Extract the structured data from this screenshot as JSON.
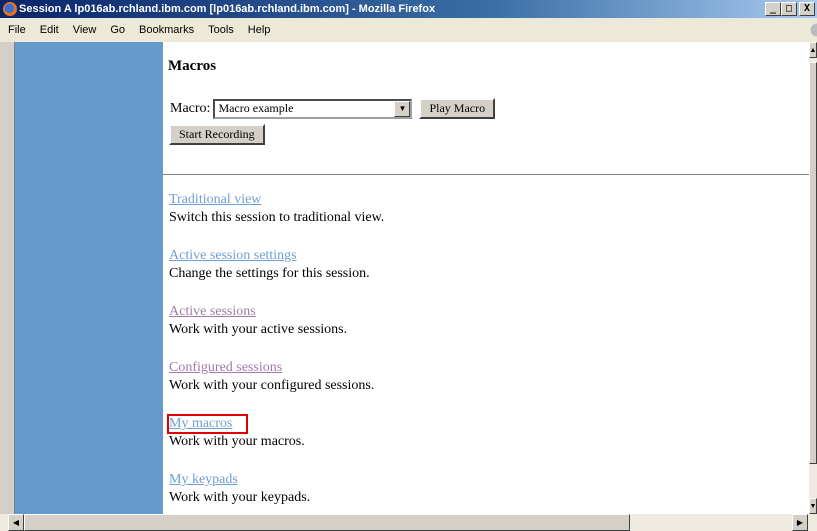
{
  "window": {
    "title": "Session A lp016ab.rchland.ibm.com [lp016ab.rchland.ibm.com] - Mozilla Firefox",
    "minimize": "_",
    "maximize": "□",
    "close": "X"
  },
  "menu": {
    "file": "File",
    "edit": "Edit",
    "view": "View",
    "go": "Go",
    "bookmarks": "Bookmarks",
    "tools": "Tools",
    "help": "Help"
  },
  "page": {
    "heading": "Macros",
    "macro_label": "Macro:",
    "macro_selected": "Macro example",
    "play_button": "Play Macro",
    "record_button": "Start Recording",
    "links": [
      {
        "label": "Traditional view",
        "desc": "Switch this session to traditional view.",
        "visited": false
      },
      {
        "label": "Active session settings",
        "desc": "Change the settings for this session.",
        "visited": false
      },
      {
        "label": "Active sessions",
        "desc": "Work with your active sessions.",
        "visited": true
      },
      {
        "label": "Configured sessions",
        "desc": "Work with your configured sessions.",
        "visited": true
      },
      {
        "label": "My macros",
        "desc": "Work with your macros.",
        "visited": false,
        "highlighted": true
      },
      {
        "label": "My keypads",
        "desc": "Work with your keypads.",
        "visited": false
      }
    ]
  },
  "colors": {
    "sidebar": "#6699cc",
    "link": "#6e9fd0",
    "visited_link": "#a07aa8",
    "highlight_box": "#e00000"
  }
}
